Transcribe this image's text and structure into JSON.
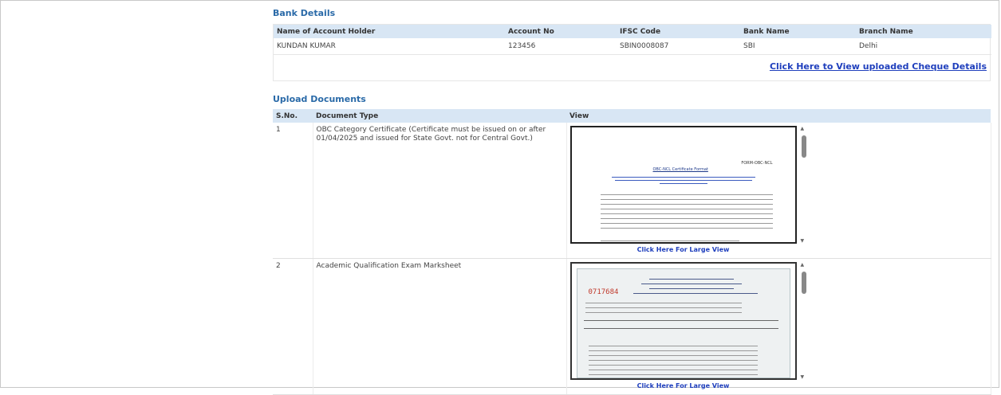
{
  "bank": {
    "title": "Bank Details",
    "headers": [
      "Name of Account Holder",
      "Account No",
      "IFSC Code",
      "Bank Name",
      "Branch Name"
    ],
    "row": [
      "KUNDAN KUMAR",
      "123456",
      "SBIN0008087",
      "SBI",
      "Delhi"
    ],
    "cheque_link": "Click Here to View uploaded Cheque Details"
  },
  "uploads": {
    "title": "Upload Documents",
    "headers": [
      "S.No.",
      "Document Type",
      "View"
    ],
    "rows": [
      {
        "sno": "1",
        "type": "OBC Category Certificate (Certificate must be issued on or after 01/04/2025 and issued for State Govt. not for Central Govt.)",
        "link": "Click Here For Large View"
      },
      {
        "sno": "2",
        "type": "Academic Qualification Exam Marksheet",
        "link": "Click Here For Large View"
      }
    ]
  },
  "obc_preview": {
    "form_id": "FORM-OBC-NCL",
    "heading": "OBC-NCL Certificate Format"
  },
  "marksheet_preview": {
    "number": "0717684"
  }
}
